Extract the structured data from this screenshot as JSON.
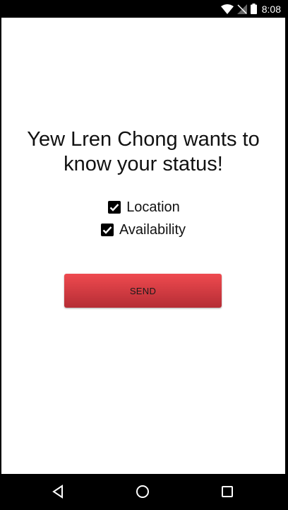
{
  "status_bar": {
    "time": "8:08",
    "icons": [
      "wifi-icon",
      "signal-icon",
      "battery-icon"
    ]
  },
  "main": {
    "prompt_line1": "Yew Lren Chong wants to",
    "prompt_line2": "know your status!",
    "checkboxes": [
      {
        "label": "Location",
        "checked": true
      },
      {
        "label": "Availability",
        "checked": true
      }
    ],
    "send_label": "SEND"
  },
  "nav_bar": {
    "icons": [
      "back-icon",
      "home-icon",
      "recents-icon"
    ]
  },
  "colors": {
    "button_top": "#ef4a4f",
    "button_bottom": "#b52d35",
    "background": "#ffffff",
    "bars": "#000000"
  }
}
